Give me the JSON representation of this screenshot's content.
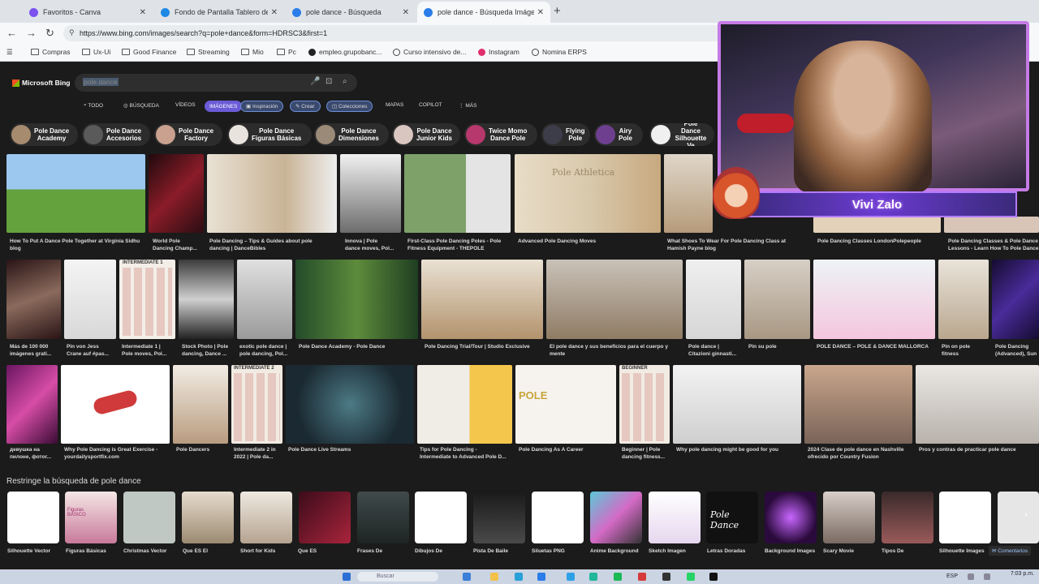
{
  "browser": {
    "tabs": [
      {
        "label": "Favoritos - Canva",
        "color": "#7b52f0"
      },
      {
        "label": "Fondo de Pantalla Tablero de Visió",
        "color": "#1e88e5"
      },
      {
        "label": "pole dance - Búsqueda",
        "color": "#2b7de9"
      },
      {
        "label": "pole dance - Búsqueda Imágenes",
        "color": "#2b7de9"
      }
    ],
    "new_tab": "+",
    "url": "https://www.bing.com/images/search?q=pole+dance&form=HDRSC3&first=1",
    "bookmarks": [
      "Compras",
      "Ux-Ui",
      "Good Finance",
      "Streaming",
      "Mio",
      "Pc",
      "empleo.grupobanc...",
      "Curso intensivo de...",
      "Instagram",
      "Nomina ERPS"
    ]
  },
  "bing": {
    "logo": "Microsoft Bing",
    "query": "pole dance",
    "tabs": [
      "TODO",
      "BÚSQUEDA",
      "VÍDEOS",
      "IMÁGENES",
      "Inspiración",
      "Crear",
      "Colecciones",
      "MAPAS",
      "COPILOT",
      "MÁS"
    ],
    "chips": [
      "Pole Dance\nAcademy",
      "Pole Dance\nAccesorios",
      "Pole Dance\nFactory",
      "Pole Dance\nFiguras Básicas",
      "Pole Dance\nDimensiones",
      "Pole Dance\nJunior Kids",
      "Twice Momo\nDance Pole",
      "Flying\nPole",
      "Airy\nPole",
      "Pole Dance\nSilhouette Ve"
    ],
    "row1_captions": [
      "How To Put A Dance Pole Together at Virginia Sidhu\nblog",
      "World Pole\nDancing Champ...",
      "Pole Dancing – Tips & Guides about pole\ndancing | DanceBibles",
      "Innova | Pole\ndance moves, Pol...",
      "First-Class Pole Dancing Poles - Pole\nFitness Equipment - THEPOLE",
      "Advanced Pole Dancing Moves",
      "What Shoes To Wear For Pole Dancing Class at\nHamish Payne blog",
      "Pole Dancing Classes LondonPolepeople",
      "Pole Dancing Classes & Pole Dance\nLessons - Learn How To Pole Dance"
    ],
    "row1_watermark": "Pole Athletica",
    "row2_captions": [
      "Más de 100 000\nimágenes grati...",
      "Pin von Jess\nCrane auf #pas...",
      "Intermediate 1 |\nPole moves, Pol...",
      "Stock Photo | Pole\ndancing, Dance ...",
      "exotic pole dance |\npole dancing, Pol...",
      "Pole Dance Academy - Pole Dance",
      "Pole Dancing Trial/Tour | Studio Exclusive",
      "El pole dance y sus beneficios para el cuerpo y\nmente",
      "Pole dance |\nCitazioni ginnasti...",
      "Pin su pole",
      "POLE DANCE – POLE & DANCE MALLORCA",
      "Pin on pole\nfitness",
      "Pole Dancing\n(Advanced), Sun"
    ],
    "row2_thumb_label": "INTERMEDIATE 1",
    "row3_captions": [
      "девушка на\nпилоне, фотог...",
      "Why Pole Dancing is Great Exercise -\nyourdailysportfix.com",
      "Pole Dancers",
      "Intermediate 2 in\n2022 | Pole da...",
      "Pole Dance Live Streams",
      "Tips for Pole Dancing -\nIntermediate to Advanced Pole D...",
      "Pole Dancing As A Career",
      "Beginner | Pole\ndancing fitness...",
      "Why pole dancing might be good for you",
      "2024 Clase de pole dance en Nashville\nofrecido por Country Fusion",
      "Pros y contras de practicar pole dance"
    ],
    "row3_thumb_labels": [
      "INTERMEDIATE 2",
      "POLE",
      "BEGINNER"
    ],
    "related_title": "Restringe la búsqueda de pole dance",
    "related": [
      "Silhouette Vector",
      "Figuras Básicas",
      "Christmas Vector",
      "Que ES El",
      "Short for Kids",
      "Que ES",
      "Frases De",
      "Dibujos De",
      "Pista De Baile",
      "Siluetas PNG",
      "Anime Background",
      "Sketch Imagen",
      "Letras Doradas",
      "Background Images",
      "Scary Movie",
      "Tipos De",
      "Silhouette Images"
    ],
    "related_thumb_labels": [
      "Figuras\nBÁSICO",
      "Pole Dance"
    ],
    "feedback": "Comentarios"
  },
  "overlay": {
    "streamer_name": "Vivi Zalo"
  },
  "taskbar": {
    "search": "Buscar",
    "lang": "ESP",
    "time": "7:03 p.m."
  }
}
